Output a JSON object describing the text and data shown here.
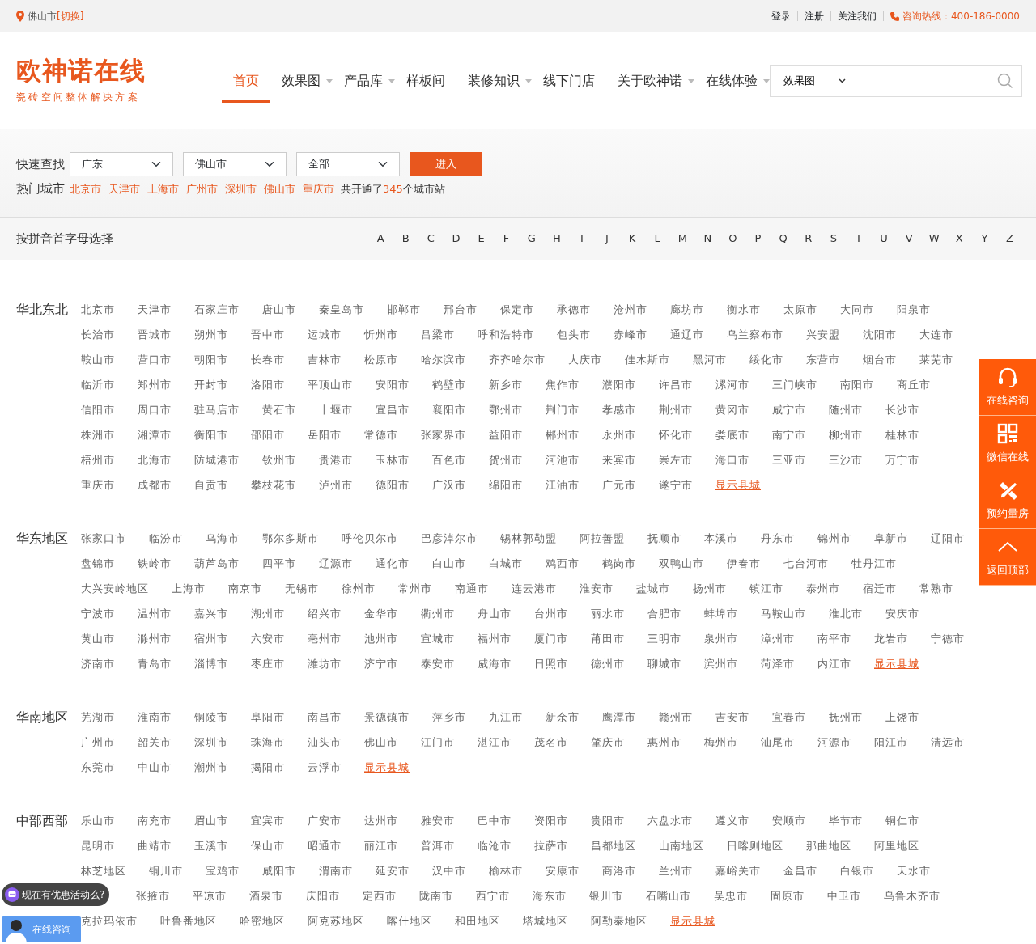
{
  "topbar": {
    "location": "佛山市",
    "switch": "[切换]",
    "links": [
      "登录",
      "注册",
      "关注我们"
    ],
    "hotline": "咨询热线：400-186-0000"
  },
  "logo": {
    "name": "欧神诺在线",
    "tagline": "瓷砖空间整体解决方案"
  },
  "nav": [
    {
      "label": "首页",
      "selected": true,
      "dropdown": false
    },
    {
      "label": "效果图",
      "selected": false,
      "dropdown": true
    },
    {
      "label": "产品库",
      "selected": false,
      "dropdown": true
    },
    {
      "label": "样板间",
      "selected": false,
      "dropdown": false
    },
    {
      "label": "装修知识",
      "selected": false,
      "dropdown": true
    },
    {
      "label": "线下门店",
      "selected": false,
      "dropdown": false
    },
    {
      "label": "关于欧神诺",
      "selected": false,
      "dropdown": true
    },
    {
      "label": "在线体验",
      "selected": false,
      "dropdown": true
    }
  ],
  "search": {
    "category": "效果图"
  },
  "quick_find": {
    "label": "快速查找",
    "selects": [
      "广东",
      "佛山市",
      "全部"
    ],
    "button": "进入"
  },
  "hot_cities": {
    "label": "热门城市",
    "cities": [
      "北京市",
      "天津市",
      "上海市",
      "广州市",
      "深圳市",
      "佛山市",
      "重庆市"
    ],
    "summary_before": "共开通了",
    "count": "345",
    "summary_after": "个城市站"
  },
  "pinyin": {
    "label": "按拼音首字母选择",
    "letters": [
      "A",
      "B",
      "C",
      "D",
      "E",
      "F",
      "G",
      "H",
      "I",
      "J",
      "K",
      "L",
      "M",
      "N",
      "O",
      "P",
      "Q",
      "R",
      "S",
      "T",
      "U",
      "V",
      "W",
      "X",
      "Y",
      "Z"
    ]
  },
  "regions": [
    {
      "name": "华北东北",
      "more": "显示县城",
      "cities": [
        "北京市",
        "天津市",
        "石家庄市",
        "唐山市",
        "秦皇岛市",
        "邯郸市",
        "邢台市",
        "保定市",
        "承德市",
        "沧州市",
        "廊坊市",
        "衡水市",
        "太原市",
        "大同市",
        "阳泉市",
        "长治市",
        "晋城市",
        "朔州市",
        "晋中市",
        "运城市",
        "忻州市",
        "吕梁市",
        "呼和浩特市",
        "包头市",
        "赤峰市",
        "通辽市",
        "乌兰察布市",
        "兴安盟",
        "沈阳市",
        "大连市",
        "鞍山市",
        "营口市",
        "朝阳市",
        "长春市",
        "吉林市",
        "松原市",
        "哈尔滨市",
        "齐齐哈尔市",
        "大庆市",
        "佳木斯市",
        "黑河市",
        "绥化市",
        "东营市",
        "烟台市",
        "莱芜市",
        "临沂市",
        "郑州市",
        "开封市",
        "洛阳市",
        "平顶山市",
        "安阳市",
        "鹤壁市",
        "新乡市",
        "焦作市",
        "濮阳市",
        "许昌市",
        "漯河市",
        "三门峡市",
        "南阳市",
        "商丘市",
        "信阳市",
        "周口市",
        "驻马店市",
        "黄石市",
        "十堰市",
        "宜昌市",
        "襄阳市",
        "鄂州市",
        "荆门市",
        "孝感市",
        "荆州市",
        "黄冈市",
        "咸宁市",
        "随州市",
        "长沙市",
        "株洲市",
        "湘潭市",
        "衡阳市",
        "邵阳市",
        "岳阳市",
        "常德市",
        "张家界市",
        "益阳市",
        "郴州市",
        "永州市",
        "怀化市",
        "娄底市",
        "南宁市",
        "柳州市",
        "桂林市",
        "梧州市",
        "北海市",
        "防城港市",
        "钦州市",
        "贵港市",
        "玉林市",
        "百色市",
        "贺州市",
        "河池市",
        "来宾市",
        "崇左市",
        "海口市",
        "三亚市",
        "三沙市",
        "万宁市",
        "重庆市",
        "成都市",
        "自贡市",
        "攀枝花市",
        "泸州市",
        "德阳市",
        "广汉市",
        "绵阳市",
        "江油市",
        "广元市",
        "遂宁市"
      ]
    },
    {
      "name": "华东地区",
      "more": "显示县城",
      "cities": [
        "张家口市",
        "临汾市",
        "乌海市",
        "鄂尔多斯市",
        "呼伦贝尔市",
        "巴彦淖尔市",
        "锡林郭勒盟",
        "阿拉善盟",
        "抚顺市",
        "本溪市",
        "丹东市",
        "锦州市",
        "阜新市",
        "辽阳市",
        "盘锦市",
        "铁岭市",
        "葫芦岛市",
        "四平市",
        "辽源市",
        "通化市",
        "白山市",
        "白城市",
        "鸡西市",
        "鹤岗市",
        "双鸭山市",
        "伊春市",
        "七台河市",
        "牡丹江市",
        "大兴安岭地区",
        "上海市",
        "南京市",
        "无锡市",
        "徐州市",
        "常州市",
        "南通市",
        "连云港市",
        "淮安市",
        "盐城市",
        "扬州市",
        "镇江市",
        "泰州市",
        "宿迁市",
        "常熟市",
        "宁波市",
        "温州市",
        "嘉兴市",
        "湖州市",
        "绍兴市",
        "金华市",
        "衢州市",
        "舟山市",
        "台州市",
        "丽水市",
        "合肥市",
        "蚌埠市",
        "马鞍山市",
        "淮北市",
        "安庆市",
        "黄山市",
        "滁州市",
        "宿州市",
        "六安市",
        "亳州市",
        "池州市",
        "宣城市",
        "福州市",
        "厦门市",
        "莆田市",
        "三明市",
        "泉州市",
        "漳州市",
        "南平市",
        "龙岩市",
        "宁德市",
        "济南市",
        "青岛市",
        "淄博市",
        "枣庄市",
        "潍坊市",
        "济宁市",
        "泰安市",
        "威海市",
        "日照市",
        "德州市",
        "聊城市",
        "滨州市",
        "菏泽市",
        "内江市"
      ]
    },
    {
      "name": "华南地区",
      "more": "显示县城",
      "cities": [
        "芜湖市",
        "淮南市",
        "铜陵市",
        "阜阳市",
        "南昌市",
        "景德镇市",
        "萍乡市",
        "九江市",
        "新余市",
        "鹰潭市",
        "赣州市",
        "吉安市",
        "宜春市",
        "抚州市",
        "上饶市",
        "广州市",
        "韶关市",
        "深圳市",
        "珠海市",
        "汕头市",
        "佛山市",
        "江门市",
        "湛江市",
        "茂名市",
        "肇庆市",
        "惠州市",
        "梅州市",
        "汕尾市",
        "河源市",
        "阳江市",
        "清远市",
        "东莞市",
        "中山市",
        "潮州市",
        "揭阳市",
        "云浮市"
      ]
    },
    {
      "name": "中部西部",
      "more": "显示县城",
      "cities": [
        "乐山市",
        "南充市",
        "眉山市",
        "宜宾市",
        "广安市",
        "达州市",
        "雅安市",
        "巴中市",
        "资阳市",
        "贵阳市",
        "六盘水市",
        "遵义市",
        "安顺市",
        "毕节市",
        "铜仁市",
        "昆明市",
        "曲靖市",
        "玉溪市",
        "保山市",
        "昭通市",
        "丽江市",
        "普洱市",
        "临沧市",
        "拉萨市",
        "昌都地区",
        "山南地区",
        "日喀则地区",
        "那曲地区",
        "阿里地区",
        "林芝地区",
        "铜川市",
        "宝鸡市",
        "咸阳市",
        "渭南市",
        "延安市",
        "汉中市",
        "榆林市",
        "安康市",
        "商洛市",
        "兰州市",
        "嘉峪关市",
        "金昌市",
        "白银市",
        "天水市",
        "张掖市",
        "平凉市",
        "酒泉市",
        "庆阳市",
        "定西市",
        "陇南市",
        "西宁市",
        "海东市",
        "银川市",
        "石嘴山市",
        "吴忠市",
        "固原市",
        "中卫市",
        "乌鲁木齐市",
        "克拉玛依市",
        "吐鲁番地区",
        "哈密地区",
        "阿克苏地区",
        "喀什地区",
        "和田地区",
        "塔城地区",
        "阿勒泰地区"
      ]
    }
  ],
  "side_tools": [
    {
      "label": "在线咨询",
      "kind": "headset"
    },
    {
      "label": "微信在线",
      "kind": "qr"
    },
    {
      "label": "预约量房",
      "kind": "tools"
    },
    {
      "label": "返回顶部",
      "kind": "top"
    }
  ],
  "promo": {
    "text": "现在有优惠活动么?"
  },
  "chat_button": {
    "label": "在线咨询"
  }
}
